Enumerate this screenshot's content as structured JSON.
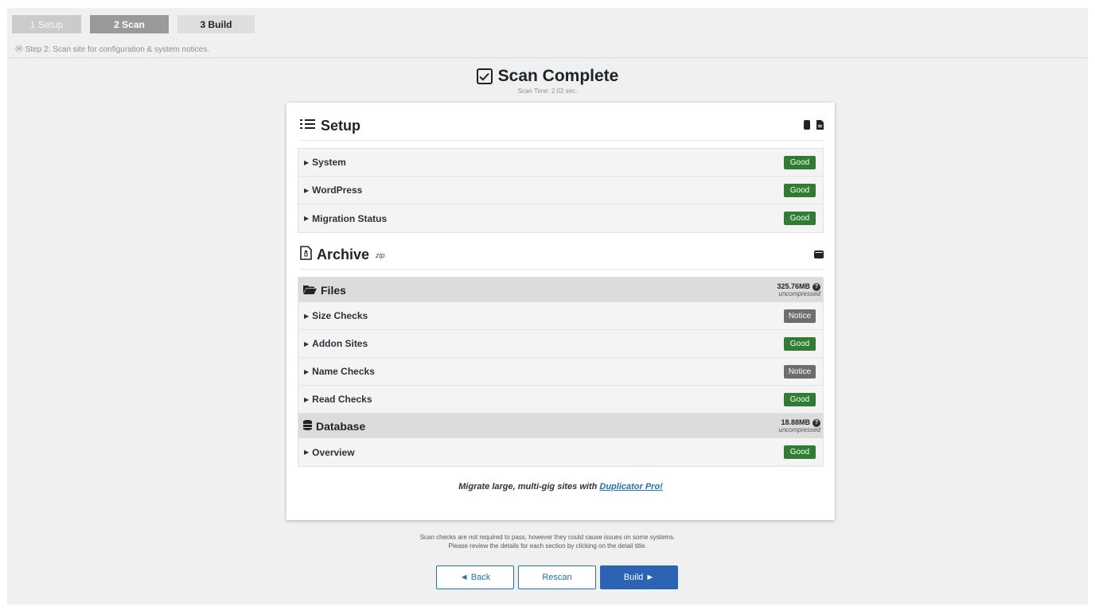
{
  "steps": [
    {
      "label": "1 Setup"
    },
    {
      "label": "2 Scan"
    },
    {
      "label": "3 Build"
    }
  ],
  "step_description": "Step 2: Scan site for configuration & system notices.",
  "header": {
    "title": "Scan Complete",
    "subtitle": "Scan Time: 2.02 sec."
  },
  "setup": {
    "title": "Setup",
    "rows": [
      {
        "label": "System",
        "status": "Good"
      },
      {
        "label": "WordPress",
        "status": "Good"
      },
      {
        "label": "Migration Status",
        "status": "Good"
      }
    ]
  },
  "archive": {
    "title": "Archive",
    "format": "zip",
    "files": {
      "title": "Files",
      "size": "325.76MB",
      "size_note": "uncompressed",
      "rows": [
        {
          "label": "Size Checks",
          "status": "Notice"
        },
        {
          "label": "Addon Sites",
          "status": "Good"
        },
        {
          "label": "Name Checks",
          "status": "Notice"
        },
        {
          "label": "Read Checks",
          "status": "Good"
        }
      ]
    },
    "database": {
      "title": "Database",
      "size": "18.88MB",
      "size_note": "uncompressed",
      "rows": [
        {
          "label": "Overview",
          "status": "Good"
        }
      ]
    }
  },
  "promo": {
    "text": "Migrate large, multi-gig sites with ",
    "link": "Duplicator Pro!"
  },
  "footer": {
    "line1": "Scan checks are not required to pass, however they could cause issues on some systems.",
    "line2": "Please review the details for each section by clicking on the detail title."
  },
  "buttons": {
    "back": "◄ Back",
    "rescan": "Rescan",
    "build": "Build ►"
  },
  "colors": {
    "good": "#2e7d32",
    "notice": "#6d6d6d",
    "primary": "#2c63b5",
    "link": "#2271b1"
  }
}
